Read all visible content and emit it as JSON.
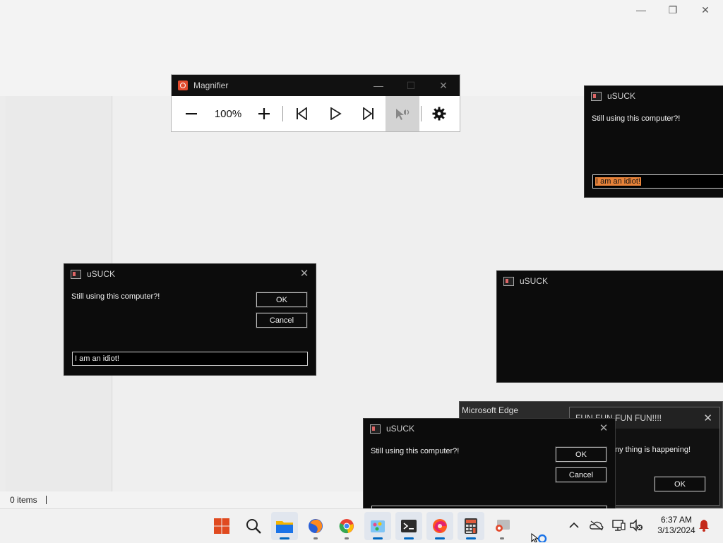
{
  "explorer": {
    "status_items": "0 items",
    "controls": {
      "minimize": "—",
      "maximize": "❐",
      "close": "✕"
    }
  },
  "magnifier": {
    "title": "Magnifier",
    "zoom_level": "100%",
    "controls": {
      "minimize": "—",
      "maximize": "☐",
      "close": "✕"
    }
  },
  "dialogs": [
    {
      "id": "dlg-top-right",
      "title": "uSUCK",
      "message": "Still using this computer?!",
      "input_value": "I am an idiot!",
      "input_selected": true
    },
    {
      "id": "dlg-left",
      "title": "uSUCK",
      "message": "Still using this computer?!",
      "ok_label": "OK",
      "cancel_label": "Cancel",
      "input_value": "I am an idiot!"
    },
    {
      "id": "dlg-mid-right",
      "title": "uSUCK"
    },
    {
      "id": "dlg-bottom",
      "title": "uSUCK",
      "message": "Still using this computer?!",
      "ok_label": "OK",
      "cancel_label": "Cancel"
    }
  ],
  "close_glyph": "✕",
  "edge_popup": {
    "title": "Microsoft Edge"
  },
  "fun_dialog": {
    "title": "FUN FUN FUN FUN!!!!",
    "message": "ny thing is happening!",
    "ok_label": "OK"
  },
  "taskbar": {
    "apps": [
      "start-icon",
      "search-icon",
      "file-explorer-icon",
      "firefox-icon",
      "chrome-icon",
      "paint-icon",
      "terminal-icon",
      "edge-icon",
      "calculator-icon",
      "magnifier-icon"
    ],
    "tray": {
      "chevron": "^",
      "time": "6:37 AM",
      "date": "3/13/2024"
    }
  },
  "colors": {
    "accent": "#0067c0",
    "selection": "#e8833a",
    "dialog_bg": "#0c0c0c",
    "notification": "#c42b1c"
  }
}
